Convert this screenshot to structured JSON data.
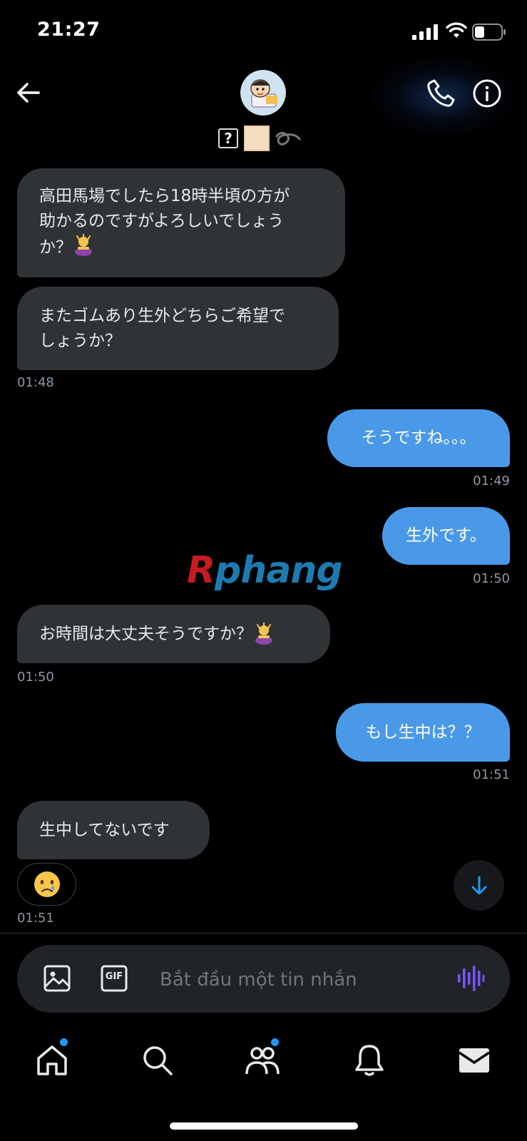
{
  "status_bar": {
    "time": "21:27"
  },
  "header": {
    "avatar_icon": "crayon-shinchan-avatar",
    "name_symbols": [
      "?"
    ]
  },
  "messages": [
    {
      "side": "received",
      "text_line1": "高田馬場でしたら18時半頃の方が",
      "text_line2": "助かるのですがよろしいでしょう",
      "text_line3": "か？",
      "emoji": "person-bowing-emoji"
    },
    {
      "side": "received",
      "text_line1": "またゴムあり生外どちらご希望で",
      "text_line2": "しょうか？",
      "time": "01:48"
    },
    {
      "side": "sent",
      "text": "そうですね。。。",
      "time": "01:49"
    },
    {
      "side": "sent",
      "text": "生外です。",
      "time": "01:50"
    },
    {
      "side": "received",
      "text": "お時間は大丈夫そうですか？",
      "emoji": "person-bowing-emoji",
      "time": "01:50"
    },
    {
      "side": "sent",
      "text": "もし生中は？？",
      "time": "01:51"
    },
    {
      "side": "received",
      "text": "生中してないです",
      "reaction": "crying-face-emoji",
      "time": "01:51"
    }
  ],
  "watermark": {
    "first": "R",
    "rest": "phang"
  },
  "composer": {
    "placeholder": "Bắt đầu một tin nhắn",
    "gif_label": "GIF"
  },
  "nav": {
    "items": [
      "home-icon",
      "search-icon",
      "communities-icon",
      "notifications-icon",
      "messages-icon"
    ],
    "badges": [
      "home",
      "communities"
    ]
  },
  "colors": {
    "sent_bubble": "#4a99e9",
    "received_bubble": "#2f3336",
    "accent": "#1d9bf0",
    "voice": "#7856ff"
  }
}
